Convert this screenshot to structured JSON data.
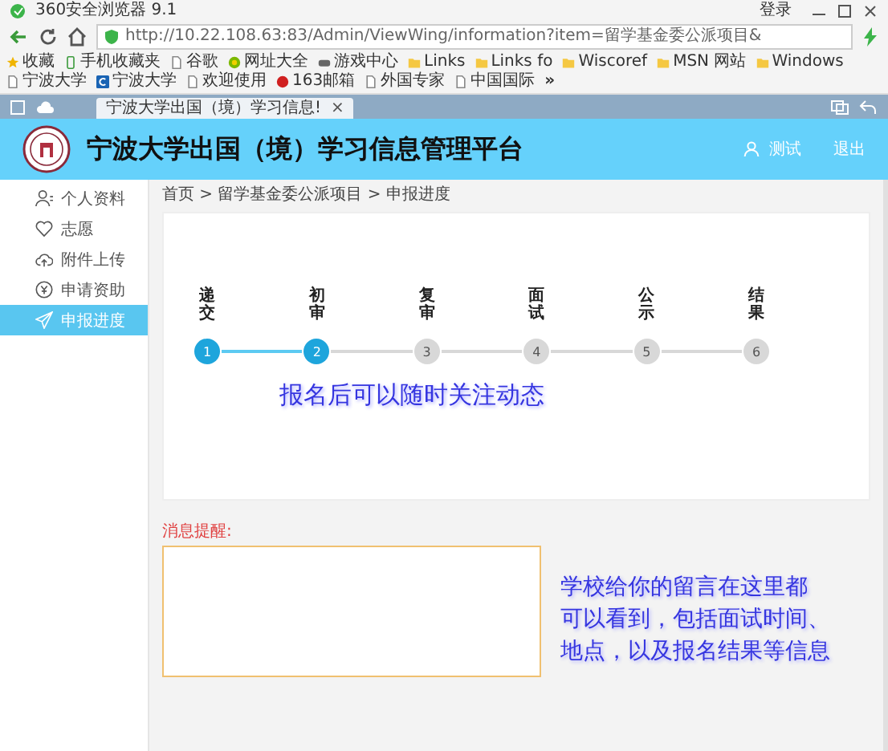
{
  "browser": {
    "title": "360安全浏览器 9.1",
    "login": "登录",
    "url": "http://10.22.108.63:83/Admin/ViewWing/information?item=留学基金委公派项目&",
    "bookmarks": [
      {
        "label": "收藏",
        "kind": "star"
      },
      {
        "label": "手机收藏夹",
        "kind": "phone"
      },
      {
        "label": "谷歌",
        "kind": "page"
      },
      {
        "label": "网址大全",
        "kind": "globe"
      },
      {
        "label": "游戏中心",
        "kind": "game"
      },
      {
        "label": "Links",
        "kind": "folder"
      },
      {
        "label": "Links fo",
        "kind": "folder"
      },
      {
        "label": "Wiscoref",
        "kind": "folder"
      },
      {
        "label": "MSN 网站",
        "kind": "folder"
      },
      {
        "label": "Windows",
        "kind": "folder"
      },
      {
        "label": "宁波大学",
        "kind": "page"
      },
      {
        "label": "宁波大学",
        "kind": "logo"
      },
      {
        "label": "欢迎使用",
        "kind": "page"
      },
      {
        "label": "163邮箱",
        "kind": "mail"
      },
      {
        "label": "外国专家",
        "kind": "page"
      },
      {
        "label": "中国国际",
        "kind": "page"
      },
      {
        "label": "»",
        "kind": "more"
      }
    ],
    "tab": {
      "title": "宁波大学出国（境）学习信息!",
      "close": "×"
    }
  },
  "header": {
    "title": "宁波大学出国（境）学习信息管理平台",
    "user": "测试",
    "logout": "退出"
  },
  "sidebar": {
    "items": [
      {
        "label": "个人资料",
        "kind": "person",
        "selected": false
      },
      {
        "label": "志愿",
        "kind": "heart",
        "selected": false
      },
      {
        "label": "附件上传",
        "kind": "cloud",
        "selected": false
      },
      {
        "label": "申请资助",
        "kind": "coin",
        "selected": false
      },
      {
        "label": "申报进度",
        "kind": "send",
        "selected": true
      }
    ]
  },
  "breadcrumb": "首页 > 留学基金委公派项目 > 申报进度",
  "steps": [
    {
      "label": "递交",
      "number": "1",
      "done": true
    },
    {
      "label": "初审",
      "number": "2",
      "done": true
    },
    {
      "label": "复审",
      "number": "3",
      "done": false
    },
    {
      "label": "面试",
      "number": "4",
      "done": false
    },
    {
      "label": "公示",
      "number": "5",
      "done": false
    },
    {
      "label": "结果",
      "number": "6",
      "done": false
    }
  ],
  "progress_note": "报名后可以随时关注动态",
  "messages": {
    "label": "消息提醒:",
    "note_lines": [
      "学校给你的留言在这里都",
      "可以看到，包括面试时间、",
      "地点，以及报名结果等信息"
    ]
  }
}
